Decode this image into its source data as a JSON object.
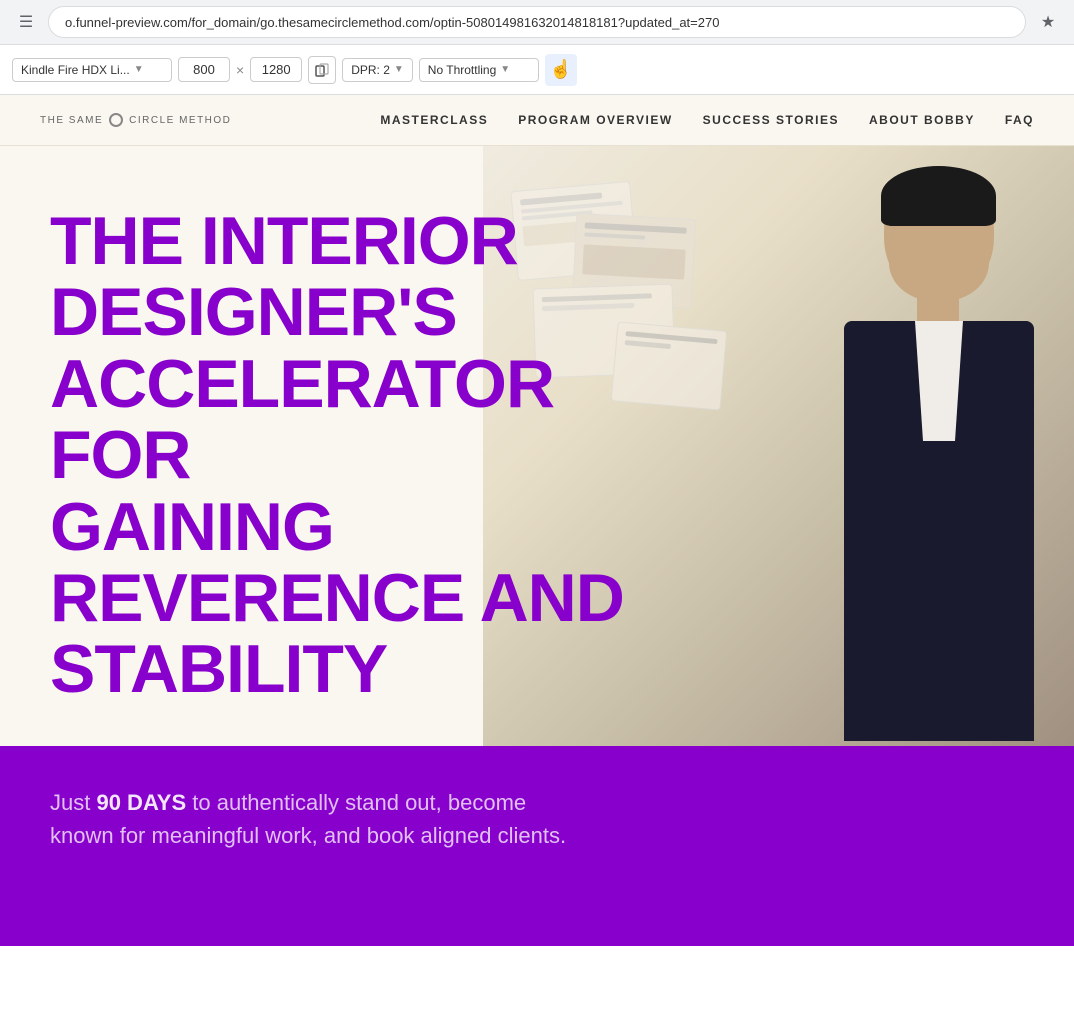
{
  "browser": {
    "address_bar_text": "o.funnel-preview.com/for_domain/go.thesamecirclemethod.com/optin-508014981632014818181?updated_at=270",
    "bookmark_icon": "☆",
    "reader_icon": "≡"
  },
  "devtools": {
    "device_label": "Kindle Fire HDX Li...",
    "width": "800",
    "height": "1280",
    "dpr_label": "DPR: 2",
    "throttle_label": "No Throttling",
    "touch_icon": "☝"
  },
  "nav": {
    "logo_text": "THE SAME ○ CIRCLE METHOD",
    "links": [
      {
        "label": "MASTERCLASS"
      },
      {
        "label": "PROGRAM OVERVIEW"
      },
      {
        "label": "SUCCESS STORIES"
      },
      {
        "label": "ABOUT BOBBY"
      },
      {
        "label": "FAQ"
      }
    ]
  },
  "hero": {
    "heading_line1": "THE INTERIOR",
    "heading_line2": "DESIGNER'S",
    "heading_line3": "ACCELERATOR FOR",
    "heading_line4": "GAINING",
    "heading_line5": "REVERENCE AND",
    "heading_line6": "STABILITY"
  },
  "subhero": {
    "text_before_bold": "Just ",
    "bold_text": "90 DAYS",
    "text_after_bold": " to authentically stand out, become known for meaningful work, and book aligned clients."
  }
}
